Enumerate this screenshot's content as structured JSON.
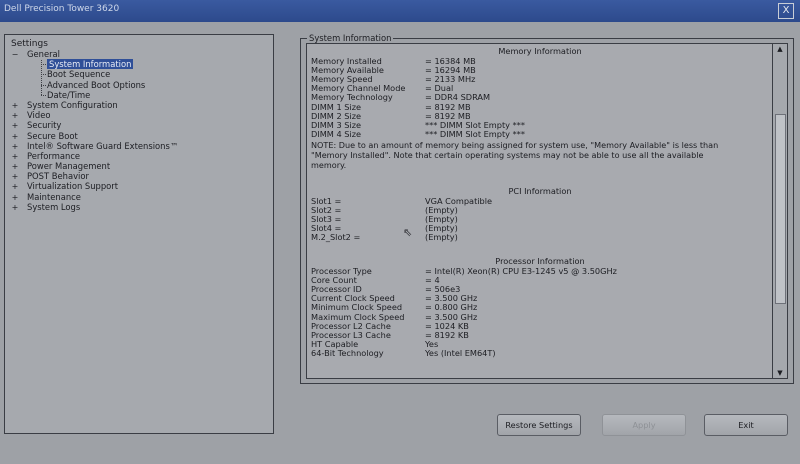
{
  "window": {
    "title": "Dell Precision Tower 3620",
    "close_label": "X"
  },
  "settings_panel": {
    "heading": "Settings",
    "items": [
      {
        "label": "General",
        "expander": "−",
        "level": 0
      },
      {
        "label": "System Information",
        "expander": "",
        "level": 1,
        "selected": true
      },
      {
        "label": "Boot Sequence",
        "expander": "",
        "level": 1
      },
      {
        "label": "Advanced Boot Options",
        "expander": "",
        "level": 1
      },
      {
        "label": "Date/Time",
        "expander": "",
        "level": 1
      },
      {
        "label": "System Configuration",
        "expander": "+",
        "level": 0
      },
      {
        "label": "Video",
        "expander": "+",
        "level": 0
      },
      {
        "label": "Security",
        "expander": "+",
        "level": 0
      },
      {
        "label": "Secure Boot",
        "expander": "+",
        "level": 0
      },
      {
        "label": "Intel® Software Guard Extensions™",
        "expander": "+",
        "level": 0
      },
      {
        "label": "Performance",
        "expander": "+",
        "level": 0
      },
      {
        "label": "Power Management",
        "expander": "+",
        "level": 0
      },
      {
        "label": "POST Behavior",
        "expander": "+",
        "level": 0
      },
      {
        "label": "Virtualization Support",
        "expander": "+",
        "level": 0
      },
      {
        "label": "Maintenance",
        "expander": "+",
        "level": 0
      },
      {
        "label": "System Logs",
        "expander": "+",
        "level": 0
      }
    ]
  },
  "system_info": {
    "legend": "System Information",
    "memory": {
      "title": "Memory Information",
      "rows": [
        {
          "k": "Memory Installed",
          "v": "= 16384 MB"
        },
        {
          "k": "Memory Available",
          "v": "= 16294 MB"
        },
        {
          "k": "Memory Speed",
          "v": "= 2133 MHz"
        },
        {
          "k": "Memory Channel Mode",
          "v": "= Dual"
        },
        {
          "k": "Memory Technology",
          "v": "= DDR4 SDRAM"
        },
        {
          "k": "DIMM 1 Size",
          "v": "= 8192 MB"
        },
        {
          "k": "DIMM 2 Size",
          "v": "= 8192 MB"
        },
        {
          "k": "DIMM 3 Size",
          "v": "*** DIMM Slot Empty ***"
        },
        {
          "k": "DIMM 4 Size",
          "v": "*** DIMM Slot Empty ***"
        }
      ],
      "note": "NOTE: Due to an amount of memory being assigned for system use, \"Memory Available\" is less than \"Memory Installed\". Note that certain operating systems may not be able to use all the available memory."
    },
    "pci": {
      "title": "PCI Information",
      "rows": [
        {
          "k": "Slot1 =",
          "v": "VGA Compatible"
        },
        {
          "k": "Slot2 =",
          "v": "(Empty)"
        },
        {
          "k": "Slot3 =",
          "v": "(Empty)"
        },
        {
          "k": "Slot4 =",
          "v": "(Empty)"
        },
        {
          "k": "M.2_Slot2 =",
          "v": "(Empty)"
        }
      ]
    },
    "processor": {
      "title": "Processor Information",
      "rows": [
        {
          "k": "Processor Type",
          "v": "= Intel(R) Xeon(R) CPU E3-1245 v5 @ 3.50GHz"
        },
        {
          "k": "Core Count",
          "v": "= 4"
        },
        {
          "k": "Processor ID",
          "v": "= 506e3"
        },
        {
          "k": "Current Clock Speed",
          "v": "= 3.500 GHz"
        },
        {
          "k": "Minimum Clock Speed",
          "v": "= 0.800 GHz"
        },
        {
          "k": "Maximum Clock Speed",
          "v": "= 3.500 GHz"
        },
        {
          "k": "Processor L2 Cache",
          "v": "= 1024 KB"
        },
        {
          "k": "Processor L3 Cache",
          "v": "= 8192 KB"
        },
        {
          "k": "HT Capable",
          "v": "Yes"
        },
        {
          "k": "64-Bit Technology",
          "v": "Yes (Intel EM64T)"
        }
      ]
    }
  },
  "scrollbar": {
    "up": "▲",
    "down": "▼"
  },
  "buttons": {
    "restore": "Restore Settings",
    "apply": "Apply",
    "exit": "Exit"
  },
  "colors": {
    "background": "#9ea1a6",
    "selection": "#2f4f98",
    "titlebar": "#2d4a8c"
  }
}
